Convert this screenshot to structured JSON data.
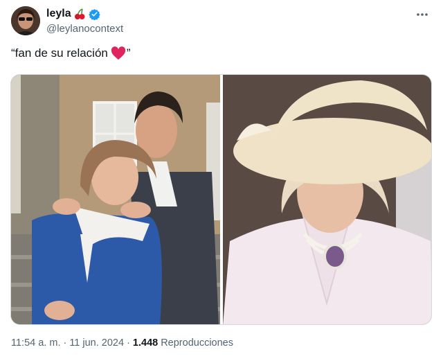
{
  "tweet": {
    "display_name": "leyla",
    "handle": "@leylanocontext",
    "text_open": "“fan de su relación",
    "text_close": "”",
    "photos": [
      {
        "name": "left-photo-couple"
      },
      {
        "name": "right-photo-woman-in-hat"
      }
    ]
  },
  "footer": {
    "time": "11:54 a. m.",
    "separator": "·",
    "date": "11 jun. 2024",
    "views_count": "1.448",
    "views_label": "Reproducciones"
  },
  "icons": {
    "name_emoji": "cherry-icon",
    "verified": "verified-icon",
    "more": "more-icon",
    "heart": "heart-icon"
  },
  "colors": {
    "verified_blue": "#1d9bf0",
    "heart_red": "#e0245e",
    "muted_text": "#536471"
  }
}
